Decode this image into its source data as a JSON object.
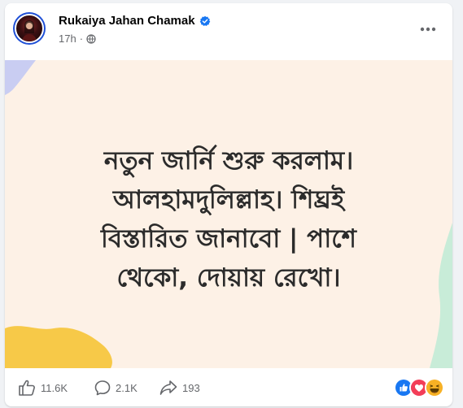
{
  "post": {
    "author": "Rukaiya Jahan Chamak",
    "time": "17h",
    "separator": "·",
    "verified": true,
    "text_lines": [
      "নতুন জার্নি শুরু করলাম।",
      "আলহামদুলিল্লাহ। শিঘ্রই",
      "বিস্তারিত জানাবো | পাশে",
      "থেকো, দোয়ায় রেখো।"
    ]
  },
  "stats": {
    "likes": "11.6K",
    "comments": "2.1K",
    "shares": "193"
  },
  "icons": {
    "verified": "verified-badge-icon",
    "audience": "globe-icon",
    "more": "more-options-icon",
    "like": "thumbs-up-icon",
    "comment": "comment-icon",
    "share": "share-icon",
    "reactions": [
      "like-reaction-icon",
      "love-reaction-icon",
      "haha-reaction-icon"
    ]
  },
  "colors": {
    "verified_blue": "#1877f2",
    "post_background": "#fdf1e6",
    "text_color": "#2b2b2b",
    "muted": "#65676b",
    "blob_yellow": "#f7c948",
    "blob_lavender": "#c9cdf2",
    "blob_mint": "#c8ecd8"
  }
}
